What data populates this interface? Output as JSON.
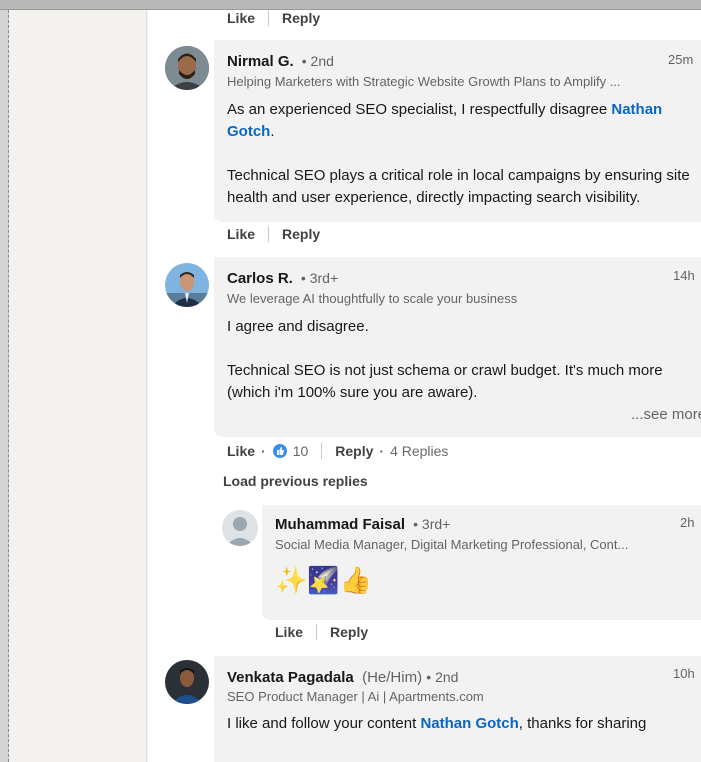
{
  "actions": {
    "like": "Like",
    "reply": "Reply"
  },
  "comments": [
    {
      "name": "Nirmal G.",
      "degree": "2nd",
      "headline": "Helping Marketers with Strategic Website Growth Plans to Amplify ...",
      "time": "25m",
      "body_pre": "As an experienced SEO specialist, I respectfully disagree ",
      "mention": "Nathan Gotch",
      "body_post": ".",
      "para2": "Technical SEO plays a critical role in local campaigns by ensuring site health and user experience, directly impacting search visibility."
    },
    {
      "name": "Carlos R.",
      "degree": "3rd+",
      "headline": "We leverage AI thoughtfully to scale your business",
      "time": "14h",
      "para1": "I agree and disagree.",
      "para2": "Technical SEO is not just schema or crawl budget. It's much more (which i'm 100% sure you are aware).",
      "see_more": "...see more",
      "reaction_count": "10",
      "replies": "4 Replies"
    },
    {
      "name": "Venkata Pagadala",
      "pronouns": "(He/Him)",
      "degree": "2nd",
      "headline": "SEO Product Manager | Ai | Apartments.com",
      "time": "10h",
      "body_pre": "I like and follow your content ",
      "mention": "Nathan Gotch",
      "body_post": ", thanks for sharing"
    }
  ],
  "load_previous": "Load previous replies",
  "reply_comment": {
    "name": "Muhammad Faisal",
    "degree": "3rd+",
    "headline": "Social Media Manager, Digital Marketing Professional, Cont...",
    "time": "2h",
    "emojis": "✨🌠👍"
  },
  "icons": [
    "like-reaction-icon",
    "default-avatar-icon"
  ],
  "colors": {
    "mention": "#0a66c2",
    "bubble": "#f2f2f2",
    "like_reaction": "#378fe9"
  }
}
